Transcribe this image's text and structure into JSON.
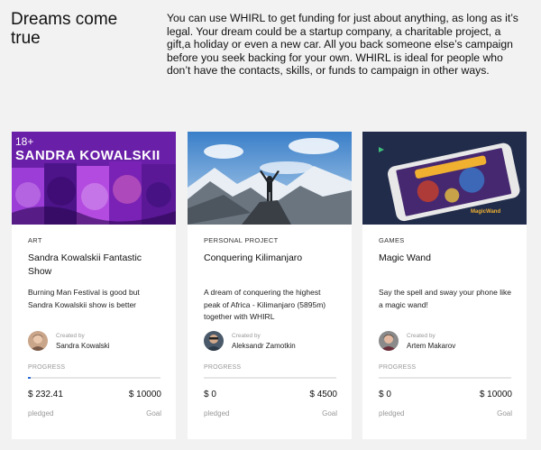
{
  "hero": {
    "title": "Dreams come true",
    "text": "You can use WHIRL to get funding for just about anything, as long as it’s legal. Your dream could be a startup company, a charitable project, a gift,a holiday or even a new car. All you back someone else’s campaign before you seek backing for your own. WHIRL is ideal for people who don’t have the contacts, skills, or funds to campaign in other ways."
  },
  "cards": [
    {
      "image_text": "SANDRA KOWALSKII",
      "image_badge": "18+",
      "category": "ART",
      "title": "Sandra Kowalskii Fantastic Show",
      "description": "Burning Man Festival is good but Sandra Kowalskii show is better",
      "created_by_label": "Created by",
      "creator": "Sandra Kowalski",
      "progress_label": "PROGRESS",
      "progress_fraction": 0.023,
      "pledged": "$ 232.41",
      "goal": "$ 10000",
      "pledged_label": "pledged",
      "goal_label": "Goal"
    },
    {
      "category": "PERSONAL PROJECT",
      "title": "Conquering Kilimanjaro",
      "description": "A dream of conquering the highest peak of Africa - Kilimanjaro (5895m) together with WHIRL",
      "created_by_label": "Created by",
      "creator": "Aleksandr Zamotkin",
      "progress_label": "PROGRESS",
      "progress_fraction": 0,
      "pledged": "$ 0",
      "goal": "$ 4500",
      "pledged_label": "pledged",
      "goal_label": "Goal"
    },
    {
      "image_text": "MagicWand",
      "category": "GAMES",
      "title": "Magic Wand",
      "description": "Say the spell and sway your phone like a magic wand!",
      "created_by_label": "Created by",
      "creator": "Artem Makarov",
      "progress_label": "PROGRESS",
      "progress_fraction": 0,
      "pledged": "$ 0",
      "goal": "$ 10000",
      "pledged_label": "pledged",
      "goal_label": "Goal"
    }
  ],
  "colors": {
    "background": "#f2f2f2",
    "card": "#ffffff",
    "progress": "#2c6cd6"
  }
}
